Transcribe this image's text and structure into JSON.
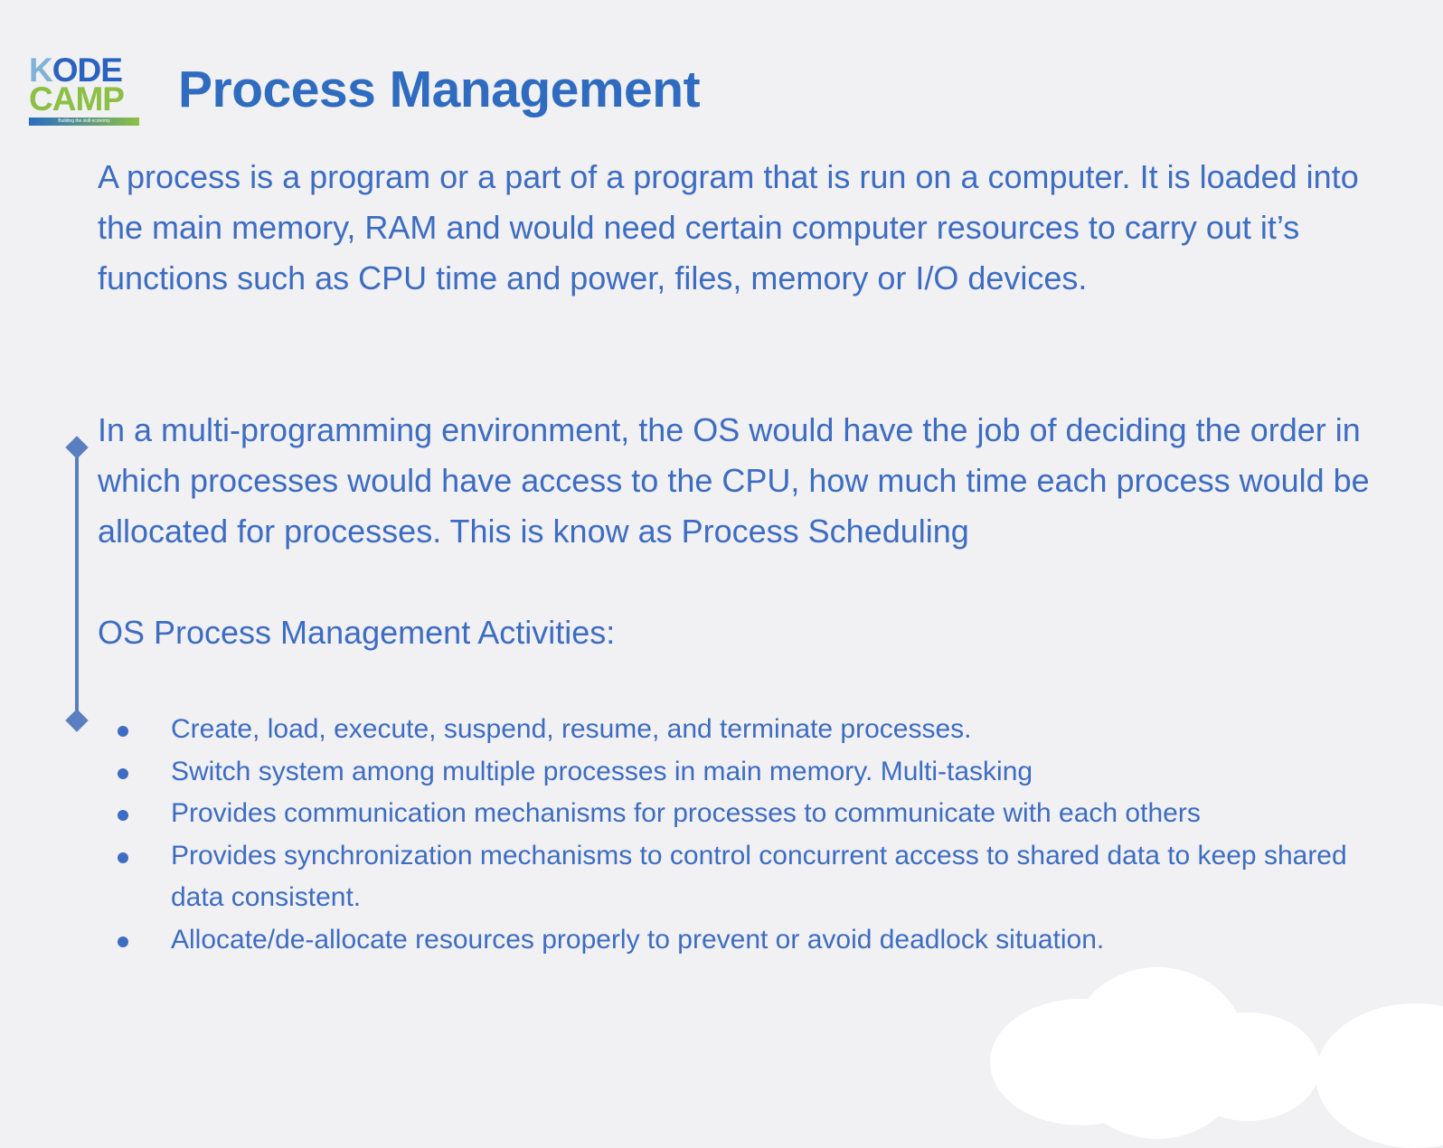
{
  "logo": {
    "line1_first": "K",
    "line1_rest": "ODE",
    "line2": "CAMP",
    "tagline": "Building the skill economy"
  },
  "title": "Process Management",
  "paragraphs": [
    "A process is a program or a part of a program that is run on a computer. It is loaded into the main memory, RAM and would need certain computer resources to carry out it’s functions such as CPU time and power, files, memory or I/O devices.",
    "In a multi-programming environment, the OS would have the job of deciding the order in which processes would have access to the CPU, how much time each process would be allocated for processes. This is know as Process Scheduling"
  ],
  "activities_heading": "OS Process Management Activities:",
  "activities": [
    "Create, load, execute, suspend, resume, and terminate processes.",
    "Switch system among multiple processes in main memory. Multi-tasking",
    "Provides communication mechanisms for processes to communicate with each others",
    "Provides synchronization mechanisms to control concurrent access to shared data to keep shared data consistent.",
    "Allocate/de-allocate resources properly to prevent or avoid deadlock situation."
  ],
  "colors": {
    "text": "#3d6dc2",
    "title": "#2f6cc0",
    "background": "#f1f0f2",
    "logo_green": "#8cc045"
  }
}
